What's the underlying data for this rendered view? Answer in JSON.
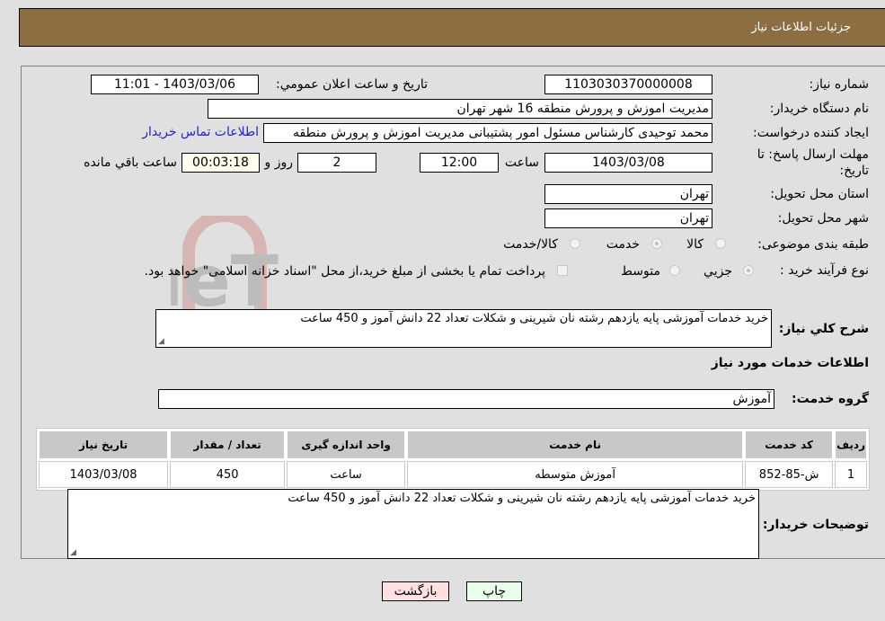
{
  "header": {
    "title": "جزئیات اطلاعات نیاز"
  },
  "form": {
    "need_number": {
      "label": "شماره نیاز:",
      "value": "1103030370000008"
    },
    "announce_datetime": {
      "label": "تاریخ و ساعت اعلان عمومي:",
      "value": "1403/03/06 - 11:01"
    },
    "buyer_org": {
      "label": "نام دستگاه خریدار:",
      "value": "مدیریت اموزش و پرورش منطقه 16 شهر تهران"
    },
    "requester": {
      "label": "ایجاد کننده درخواست:",
      "value": "محمد توحیدی کارشناس مسئول امور پشتیبانی مدیریت اموزش و پرورش منطقه"
    },
    "buyer_contact_link": "اطلاعات تماس خریدار",
    "deadline": {
      "label_line1": "مهلت ارسال پاسخ: تا",
      "label_line2": "تاریخ:",
      "date": "1403/03/08",
      "time_label": "ساعت",
      "time": "12:00",
      "days": "2",
      "days_label": "روز و",
      "remaining": "00:03:18",
      "remaining_label": "ساعت باقي مانده"
    },
    "province": {
      "label": "استان محل تحویل:",
      "value": "تهران"
    },
    "city": {
      "label": "شهر محل تحویل:",
      "value": "تهران"
    },
    "category": {
      "label": "طبقه بندی موضوعی:",
      "options": [
        "کالا",
        "خدمت",
        "کالا/خدمت"
      ],
      "selected": "خدمت"
    },
    "purchase_type": {
      "label": "نوع فرآیند خرید :",
      "options": [
        "جزيي",
        "متوسط"
      ],
      "selected": "جزيي",
      "treasury_note": "پرداخت تمام یا بخشی از مبلغ خرید،از محل \"اسناد خزانه اسلامی\" خواهد بود."
    },
    "general_description": {
      "label": "شرح کلي نیاز:",
      "value": "خرید خدمات آموزشی پایه یازدهم رشته نان شیرینی و شکلات تعداد 22 دانش آموز و 450 ساعت"
    },
    "services_section_title": "اطلاعات خدمات مورد نیاز",
    "service_group": {
      "label": "گروه خدمت:",
      "value": "آموزش"
    }
  },
  "table": {
    "headers": [
      "ردیف",
      "کد خدمت",
      "نام خدمت",
      "واحد اندازه گیری",
      "تعداد / مقدار",
      "تاریخ نیاز"
    ],
    "rows": [
      [
        "1",
        "ش-85-852",
        "آموزش متوسطه",
        "ساعت",
        "450",
        "1403/03/08"
      ]
    ]
  },
  "buyer_notes": {
    "label": "توضیحات خریدار:",
    "value": "خرید خدمات آموزشی پایه یازدهم رشته نان شیرینی و شکلات تعداد 22 دانش آموز و 450 ساعت"
  },
  "buttons": {
    "print": "چاپ",
    "back": "بازگشت"
  },
  "watermark": "AriaTender.neT",
  "colors": {
    "header_bg": "#8d6e43",
    "print_btn_bg": "#eaffea",
    "back_btn_bg": "#ffe0e0",
    "remaining_bg": "#fffde8"
  }
}
